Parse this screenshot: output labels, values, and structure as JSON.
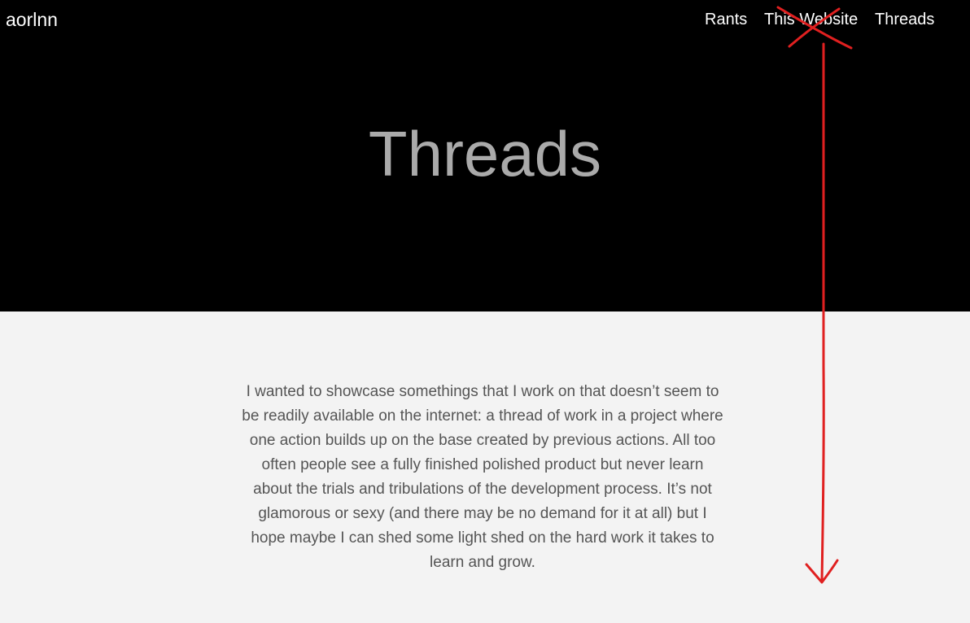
{
  "brand": {
    "name": "aorlnn"
  },
  "nav": {
    "items": [
      {
        "label": "Rants"
      },
      {
        "label": "This Website"
      },
      {
        "label": "Threads"
      }
    ]
  },
  "hero": {
    "title": "Threads"
  },
  "main": {
    "intro": "I wanted to showcase somethings that I work on that doesn’t seem to be readily available on the internet: a thread of work in a project where one action builds up on the base created by previous actions. All too often people see a fully finished polished product but never learn about the trials and tribulations of the development process. It’s not glamorous or sexy (and there may be no demand for it at all) but I hope maybe I can shed some light shed on the hard work it takes to learn and grow."
  },
  "colors": {
    "header_bg": "#000000",
    "body_bg": "#f3f3f3",
    "title_text": "#aaaaaa",
    "body_text": "#555555",
    "annotation": "#e02020"
  },
  "annotations": {
    "strikethrough_target": "This Website",
    "arrow_direction": "down"
  }
}
